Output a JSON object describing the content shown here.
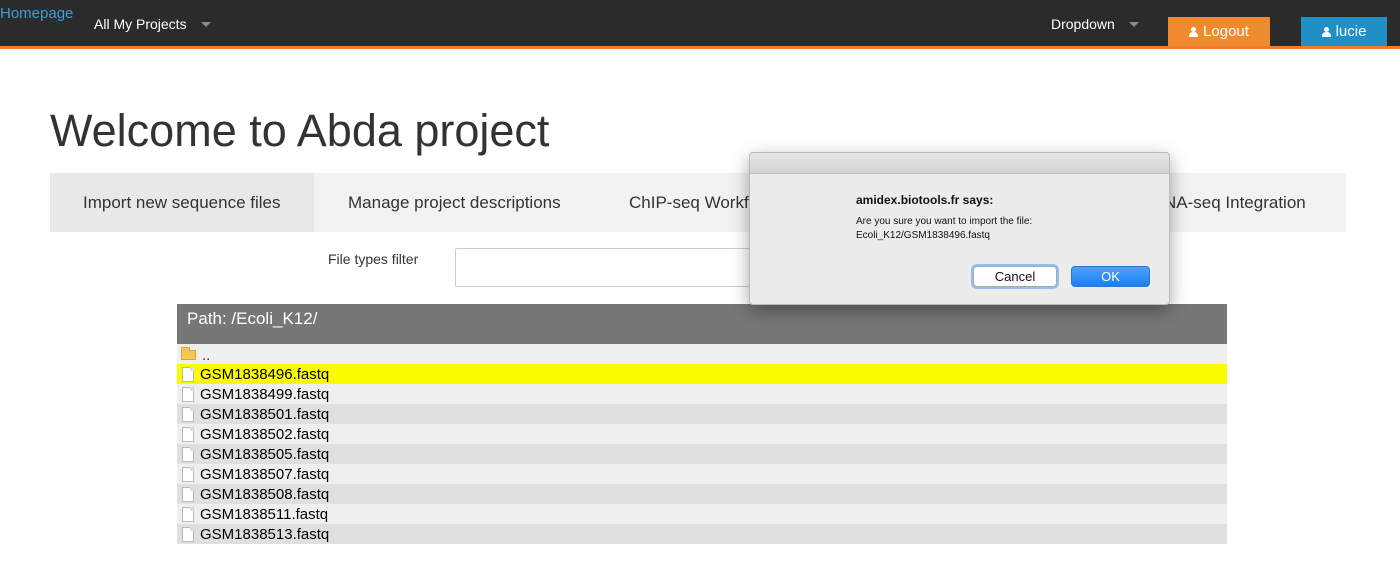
{
  "navbar": {
    "brand": "Homepage",
    "projects_dropdown": "All My Projects",
    "dropdown": "Dropdown",
    "logout_label": "Logout",
    "user_label": "lucie"
  },
  "page": {
    "title": "Welcome to Abda project"
  },
  "tabs": [
    {
      "label": "Import new sequence files"
    },
    {
      "label": "Manage project descriptions"
    },
    {
      "label": "ChIP-seq Workfl"
    },
    {
      "label": "NA-seq Integration"
    }
  ],
  "filter": {
    "label": "File types filter",
    "value": ""
  },
  "browser": {
    "path": "Path: /Ecoli_K12/",
    "parent": "..",
    "files": [
      {
        "name": "GSM1838496.fastq"
      },
      {
        "name": "GSM1838499.fastq"
      },
      {
        "name": "GSM1838501.fastq"
      },
      {
        "name": "GSM1838502.fastq"
      },
      {
        "name": "GSM1838505.fastq"
      },
      {
        "name": "GSM1838507.fastq"
      },
      {
        "name": "GSM1838508.fastq"
      },
      {
        "name": "GSM1838511.fastq"
      },
      {
        "name": "GSM1838513.fastq"
      }
    ]
  },
  "dialog": {
    "heading": "amidex.biotools.fr says:",
    "message_line1": "Are you sure you want to import the file:",
    "message_line2": "Ecoli_K12/GSM1838496.fastq",
    "cancel_label": "Cancel",
    "ok_label": "OK"
  },
  "colors": {
    "navbar_bg": "#2b2b2b",
    "accent_orange": "#ef8a2f",
    "user_blue": "#1f8fc6",
    "brand_link": "#3a9fd8",
    "selected_row": "#fbfb00"
  }
}
